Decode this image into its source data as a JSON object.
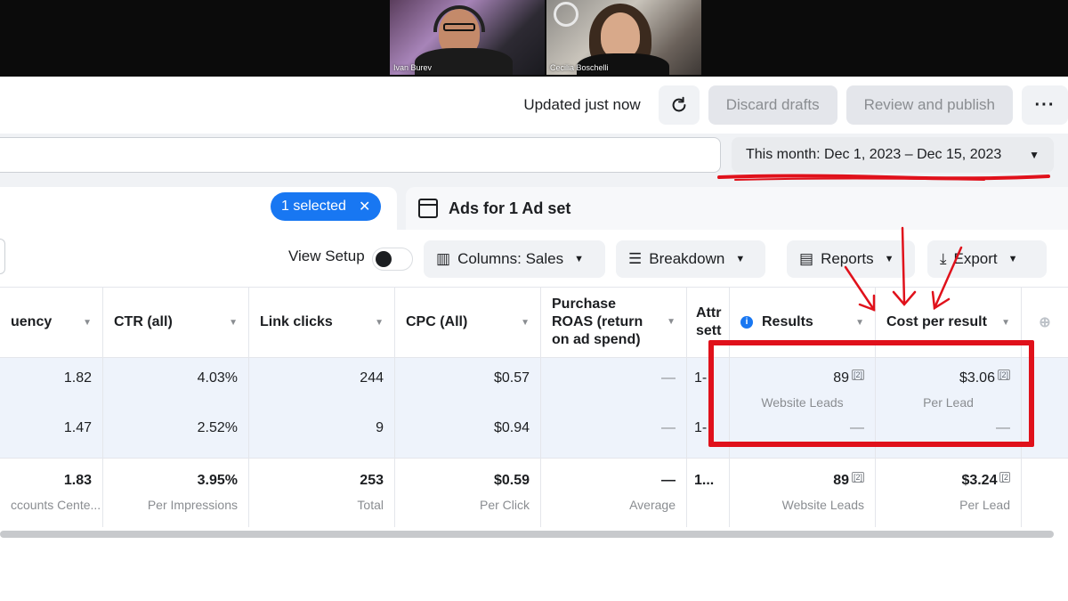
{
  "video_call": {
    "participants": [
      {
        "name": "Ivan Burev"
      },
      {
        "name": "Cecilia Boschelli"
      }
    ]
  },
  "header": {
    "updated_text": "Updated just now",
    "discard_label": "Discard drafts",
    "review_label": "Review and publish",
    "more_label": "···"
  },
  "date_range": {
    "label": "This month: Dec 1, 2023 – Dec 15, 2023"
  },
  "tabs": {
    "selected_label": "1 selected",
    "selected_close": "✕",
    "ads_label": "Ads for 1 Ad set"
  },
  "toolbar": {
    "view_setup_label": "View Setup",
    "columns_label": "Columns: Sales",
    "breakdown_label": "Breakdown",
    "reports_label": "Reports",
    "export_label": "Export"
  },
  "table": {
    "columns": [
      {
        "label": "uency"
      },
      {
        "label": "CTR (all)"
      },
      {
        "label": "Link clicks"
      },
      {
        "label": "CPC (All)"
      },
      {
        "label": "Purchase ROAS (return on ad spend)"
      },
      {
        "label": "Attr sett"
      },
      {
        "label": "Results"
      },
      {
        "label": "Cost per result"
      }
    ],
    "rows": [
      {
        "frequency": "1.82",
        "ctr": "4.03%",
        "link_clicks": "244",
        "cpc": "$0.57",
        "roas": "—",
        "attr": "1-",
        "results": "89",
        "results_sub": "Website Leads",
        "results_ref": "[2]",
        "cost": "$3.06",
        "cost_sub": "Per Lead",
        "cost_ref": "[2]"
      },
      {
        "frequency": "1.47",
        "ctr": "2.52%",
        "link_clicks": "9",
        "cpc": "$0.94",
        "roas": "—",
        "attr": "1-",
        "results": "—",
        "cost": "—"
      }
    ],
    "totals": {
      "frequency": "1.83",
      "frequency_sub": "ccounts Cente...",
      "ctr": "3.95%",
      "ctr_sub": "Per Impressions",
      "link_clicks": "253",
      "link_clicks_sub": "Total",
      "cpc": "$0.59",
      "cpc_sub": "Per Click",
      "roas": "—",
      "roas_sub": "Average",
      "attr": "1...",
      "results": "89",
      "results_ref": "[2]",
      "results_sub": "Website Leads",
      "cost": "$3.24",
      "cost_ref": "[2",
      "cost_sub": "Per Lead"
    }
  },
  "colors": {
    "accent": "#1877f2",
    "annotation_red": "#e0111b"
  }
}
